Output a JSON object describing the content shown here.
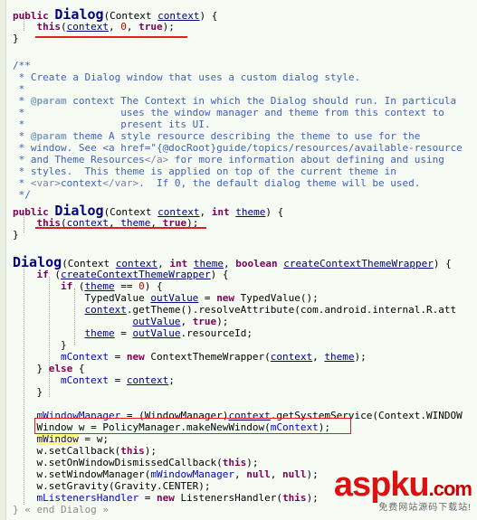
{
  "code_lines": [
    "public Dialog(Context context) {",
    "    this(context, 0, true);",
    "}",
    "",
    "/**",
    " * Create a Dialog window that uses a custom dialog style.",
    " *",
    " * @param context The Context in which the Dialog should run. In particula",
    " *                uses the window manager and theme from this context to",
    " *                present its UI.",
    " * @param theme A style resource describing the theme to use for the",
    " * window. See <a href=\"{@docRoot}guide/topics/resources/available-resource",
    " * and Theme Resources</a> for more information about defining and using",
    " * styles.  This theme is applied on top of the current theme in",
    " * <var>context</var>.  If 0, the default dialog theme will be used.",
    " */",
    "public Dialog(Context context, int theme) {",
    "    this(context, theme, true);",
    "}",
    "",
    "Dialog(Context context, int theme, boolean createContextThemeWrapper) {",
    "    if (createContextThemeWrapper) {",
    "        if (theme == 0) {",
    "            TypedValue outValue = new TypedValue();",
    "            context.getTheme().resolveAttribute(com.android.internal.R.att",
    "                    outValue, true);",
    "            theme = outValue.resourceId;",
    "        }",
    "        mContext = new ContextThemeWrapper(context, theme);",
    "    } else {",
    "        mContext = context;",
    "    }",
    "",
    "    mWindowManager = (WindowManager)context.getSystemService(Context.WINDOW",
    "    Window w = PolicyManager.makeNewWindow(mContext);",
    "    mWindow = w;",
    "    w.setCallback(this);",
    "    w.setOnWindowDismissedCallback(this);",
    "    w.setWindowManager(mWindowManager, null, null);",
    "    w.setGravity(Gravity.CENTER);",
    "    mListenersHandler = new ListenersHandler(this);"
  ],
  "fold_marker": "} « end Dialog »",
  "watermark": {
    "main": "aspku",
    "domain": ".com",
    "sub": "免费网站源码下载站!"
  }
}
